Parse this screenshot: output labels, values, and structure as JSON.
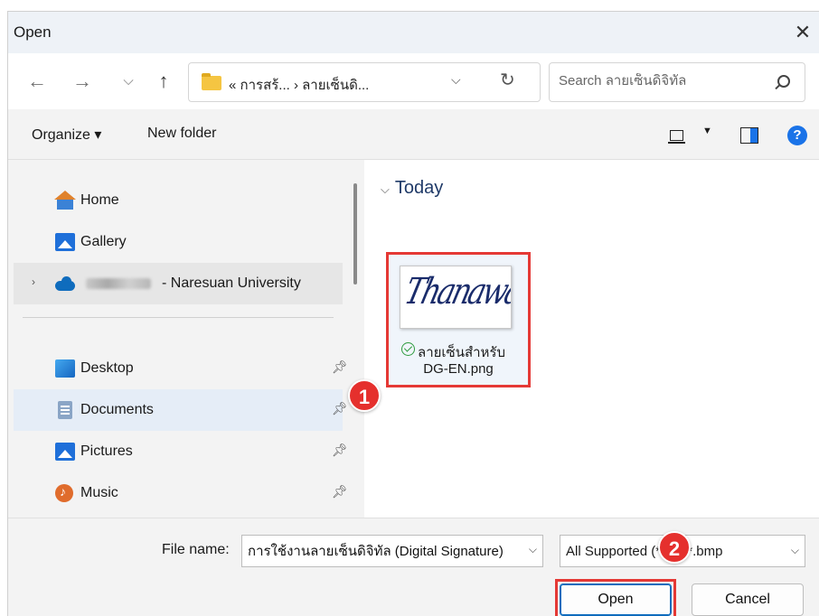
{
  "window": {
    "title": "Open",
    "close_label": "✕"
  },
  "address": {
    "path": "« การสร้... › ลายเซ็นดิ...",
    "search_placeholder": "Search ลายเซ็นดิจิทัล"
  },
  "toolbar": {
    "organize_label": "Organize ▾",
    "new_folder_label": "New folder"
  },
  "nav": {
    "home": "Home",
    "gallery": "Gallery",
    "onedrive": "- Naresuan University",
    "desktop": "Desktop",
    "documents": "Documents",
    "pictures": "Pictures",
    "music": "Music"
  },
  "content": {
    "group_label": "Today",
    "file": {
      "name_line1": "ลายเซ็นสำหรับ",
      "name_line2": "DG-EN.png",
      "thumbnail_text": "Thanawal"
    }
  },
  "bottom": {
    "file_name_label": "File name:",
    "file_name_value": "การใช้งานลายเซ็นดิจิทัล (Digital Signature)",
    "file_type": "All Supported (*.pdf;*.bmp",
    "open_label": "Open",
    "cancel_label": "Cancel"
  },
  "annotations": {
    "step1": "1",
    "step2": "2"
  },
  "colors": {
    "accent": "#0f6cbd",
    "highlight_red": "#e53935",
    "group_header": "#1f3a68"
  }
}
